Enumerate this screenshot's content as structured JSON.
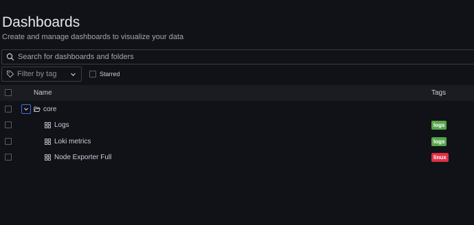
{
  "header": {
    "title": "Dashboards",
    "subtitle": "Create and manage dashboards to visualize your data"
  },
  "search": {
    "placeholder": "Search for dashboards and folders",
    "value": "",
    "icon": "search-icon"
  },
  "filters": {
    "tag_filter_label": "Filter by tag",
    "starred_label": "Starred",
    "starred_checked": false
  },
  "table": {
    "columns": {
      "name": "Name",
      "tags": "Tags"
    },
    "folder": {
      "name": "core",
      "expanded": true
    },
    "rows": [
      {
        "name": "Logs",
        "tag": "logs",
        "tag_color": "#56a64b"
      },
      {
        "name": "Loki metrics",
        "tag": "logs",
        "tag_color": "#56a64b"
      },
      {
        "name": "Node Exporter Full",
        "tag": "linux",
        "tag_color": "#e02f44"
      }
    ]
  },
  "colors": {
    "background": "#111217",
    "header_row": "#1b1c21",
    "focus_blue": "#3d71d9"
  }
}
